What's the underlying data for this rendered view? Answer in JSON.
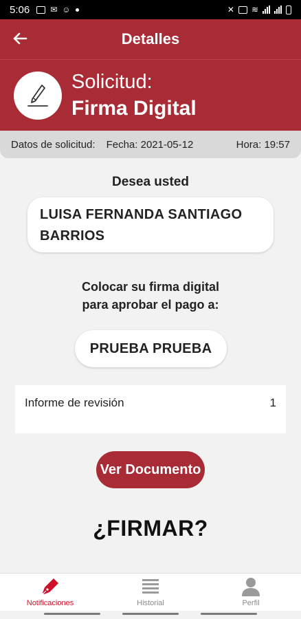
{
  "status_bar": {
    "time": "5:06",
    "left_icons": [
      "image-icon",
      "mail-icon",
      "app-icon",
      "dot-icon"
    ],
    "right_icons": [
      "mute-icon",
      "nfc-icon",
      "wifi-icon",
      "signal-icon",
      "signal-icon",
      "battery-icon"
    ]
  },
  "header": {
    "title": "Detalles",
    "back_icon": "arrow-left-icon"
  },
  "hero": {
    "icon": "pen-signature-icon",
    "line1": "Solicitud:",
    "line2": "Firma Digital"
  },
  "meta": {
    "label": "Datos de solicitud:",
    "date": "Fecha: 2021-05-12",
    "time": "Hora: 19:57"
  },
  "content": {
    "question1": "Desea usted",
    "person_name": "LUISA FERNANDA SANTIAGO BARRIOS",
    "question2_line1": "Colocar su firma digital",
    "question2_line2": "para aprobar el pago a:",
    "payee": "PRUEBA PRUEBA",
    "report_label": "Informe de revisión",
    "report_value": "1",
    "view_button": "Ver Documento",
    "sign_prompt": "¿FIRMAR?"
  },
  "bottom_nav": {
    "items": [
      {
        "label": "Notificaciones",
        "icon": "pen-nib-icon",
        "active": true
      },
      {
        "label": "Historial",
        "icon": "list-icon",
        "active": false
      },
      {
        "label": "Perfil",
        "icon": "user-icon",
        "active": false
      }
    ]
  },
  "colors": {
    "brand": "#a82b35",
    "active_nav": "#d0102a",
    "background": "#f2f2f2"
  }
}
